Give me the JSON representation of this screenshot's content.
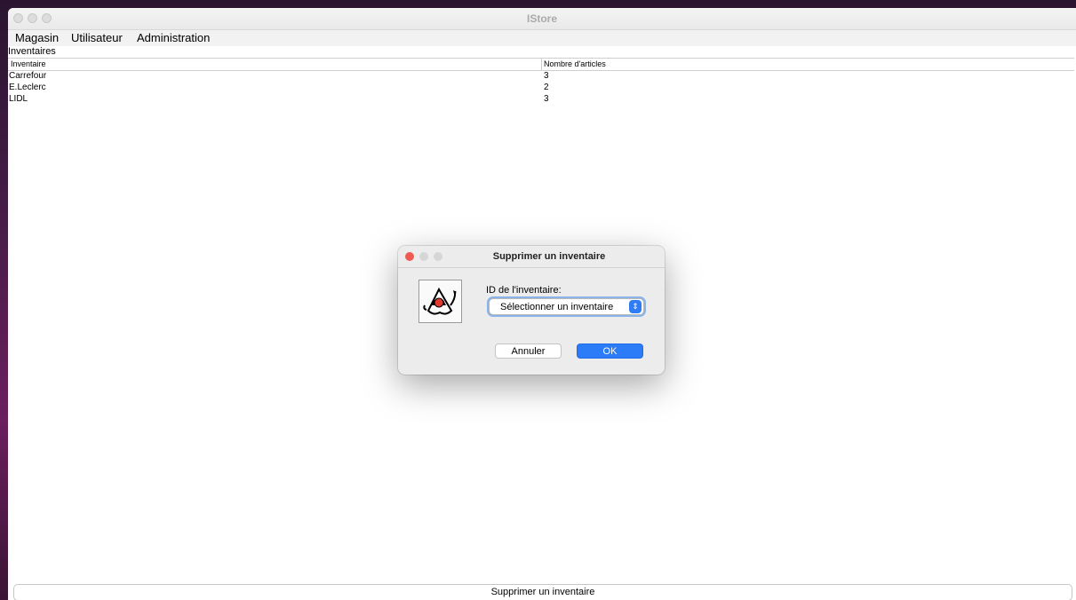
{
  "window": {
    "title": "IStore"
  },
  "menu": {
    "items": [
      "Magasin",
      "Utilisateur",
      "Administration"
    ]
  },
  "panel": {
    "title": "Inventaires"
  },
  "table": {
    "columns": [
      "Inventaire",
      "Nombre d'articles"
    ],
    "rows": [
      [
        "Carrefour",
        "3"
      ],
      [
        "E.Leclerc",
        "2"
      ],
      [
        "LIDL",
        "3"
      ]
    ]
  },
  "bottom_button": {
    "label": "Supprimer un inventaire"
  },
  "dialog": {
    "title": "Supprimer un inventaire",
    "field_label": "ID de l'inventaire:",
    "select_value": "Sélectionner un inventaire",
    "cancel_label": "Annuler",
    "ok_label": "OK",
    "icon": "java-duke-icon"
  },
  "colors": {
    "accent": "#2b7cf6",
    "close_light": "#ee5a52"
  }
}
